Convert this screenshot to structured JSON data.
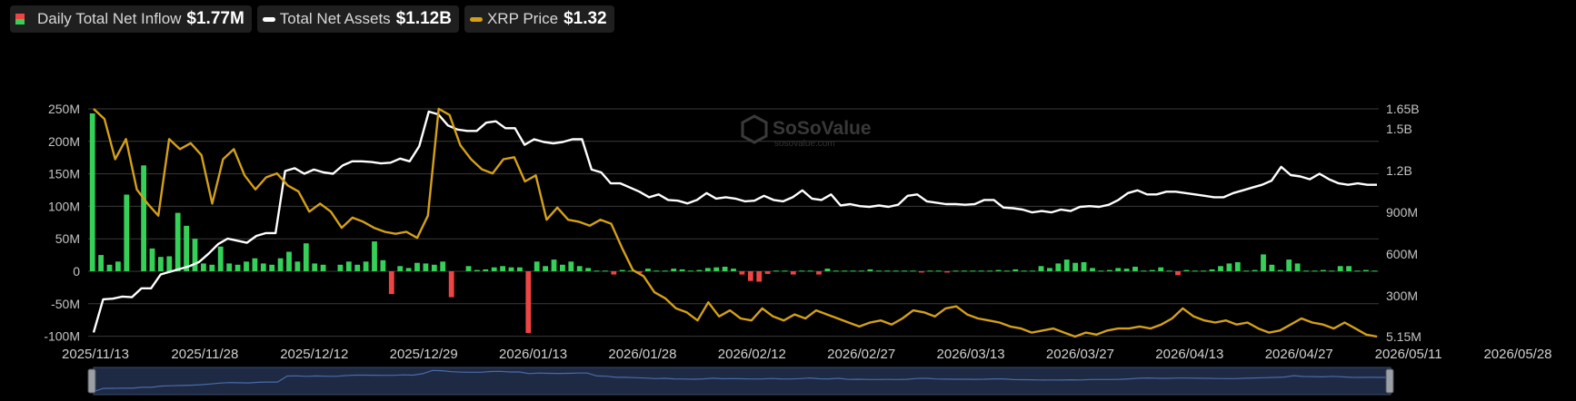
{
  "legend": [
    {
      "label": "Daily Total Net Inflow",
      "value": "$1.77M",
      "icon": "bar-swatch"
    },
    {
      "label": "Total Net Assets",
      "value": "$1.12B",
      "icon": "line-swatch",
      "color": "#ffffff"
    },
    {
      "label": "XRP Price",
      "value": "$1.32",
      "icon": "line-swatch",
      "color": "#d4a017"
    }
  ],
  "watermark": {
    "brand": "SoSoValue",
    "url": "sosovalue.com"
  },
  "chart_data": {
    "type": "bar",
    "x_ticks": [
      "2025/11/13",
      "2025/11/28",
      "2025/12/12",
      "2025/12/29",
      "2026/01/13",
      "2026/01/28",
      "2026/02/12",
      "2026/02/27",
      "2026/03/13",
      "2026/03/27",
      "2026/04/13",
      "2026/04/27",
      "2026/05/11",
      "2026/05/28"
    ],
    "y_left_ticks": [
      "250M",
      "200M",
      "150M",
      "100M",
      "50M",
      "0",
      "-50M",
      "-100M"
    ],
    "y_left_range": [
      -100,
      250
    ],
    "y_right_ticks": [
      "1.65B",
      "1.5B",
      "1.2B",
      "900M",
      "600M",
      "300M",
      "5.15M"
    ],
    "grid": true,
    "legend_position": "top-left",
    "colors": {
      "positive": "#34d058",
      "negative": "#ef4444",
      "assets": "#ffffff",
      "price": "#d4a017",
      "grid": "#3a3a3a"
    },
    "series": [
      {
        "name": "Daily Total Net Inflow",
        "type": "bar",
        "unit": "M USD",
        "values": [
          243,
          25,
          10,
          15,
          118,
          0,
          163,
          35,
          22,
          23,
          90,
          70,
          50,
          12,
          10,
          38,
          12,
          10,
          15,
          20,
          12,
          10,
          20,
          30,
          15,
          43,
          12,
          10,
          0,
          10,
          15,
          10,
          15,
          46,
          17,
          -35,
          8,
          5,
          13,
          12,
          10,
          15,
          -40,
          0,
          8,
          2,
          3,
          6,
          8,
          6,
          6,
          -95,
          15,
          8,
          18,
          10,
          15,
          8,
          5,
          1,
          1,
          -5,
          2,
          1,
          -3,
          4,
          1,
          1,
          4,
          3,
          1,
          2,
          5,
          6,
          7,
          4,
          -5,
          -15,
          -16,
          -4,
          1,
          1,
          -5,
          1,
          1,
          -5,
          4,
          1,
          1,
          1,
          1,
          3,
          1,
          1,
          1,
          1,
          1,
          -2,
          1,
          1,
          -2,
          1,
          1,
          1,
          1,
          1,
          2,
          1,
          3,
          1,
          1,
          8,
          5,
          12,
          18,
          13,
          14,
          5,
          1,
          2,
          5,
          4,
          7,
          1,
          2,
          6,
          1,
          -6,
          2,
          1,
          1,
          3,
          8,
          12,
          14,
          1,
          2,
          26,
          10,
          2,
          18,
          12,
          1,
          1,
          2,
          1,
          8,
          8,
          1,
          2,
          1
        ],
        "date_range": [
          "2025/11/13",
          "2026/05/28"
        ]
      },
      {
        "name": "Total Net Assets",
        "type": "line",
        "unit": "M USD",
        "values": [
          30,
          270,
          275,
          290,
          285,
          350,
          350,
          450,
          470,
          490,
          510,
          540,
          600,
          670,
          710,
          695,
          680,
          730,
          750,
          750,
          1200,
          1220,
          1180,
          1210,
          1190,
          1180,
          1240,
          1270,
          1270,
          1265,
          1255,
          1260,
          1290,
          1270,
          1380,
          1630,
          1610,
          1530,
          1500,
          1490,
          1490,
          1550,
          1560,
          1510,
          1510,
          1390,
          1430,
          1410,
          1400,
          1410,
          1430,
          1430,
          1210,
          1190,
          1110,
          1110,
          1080,
          1050,
          1010,
          1030,
          990,
          985,
          965,
          990,
          1040,
          1000,
          1010,
          1000,
          980,
          985,
          1020,
          990,
          980,
          1010,
          1060,
          1000,
          990,
          1030,
          950,
          960,
          945,
          940,
          950,
          940,
          955,
          1020,
          1030,
          980,
          970,
          960,
          960,
          955,
          960,
          990,
          990,
          935,
          930,
          920,
          900,
          910,
          900,
          920,
          910,
          940,
          945,
          940,
          955,
          990,
          1040,
          1060,
          1030,
          1030,
          1050,
          1050,
          1040,
          1030,
          1020,
          1010,
          1010,
          1040,
          1060,
          1080,
          1100,
          1130,
          1230,
          1170,
          1160,
          1140,
          1180,
          1140,
          1110,
          1100,
          1110,
          1100,
          1100
        ]
      },
      {
        "name": "XRP Price",
        "type": "line",
        "unit": "USD",
        "values": [
          2.45,
          2.4,
          2.2,
          2.3,
          2.05,
          1.98,
          1.92,
          2.3,
          2.25,
          2.28,
          2.22,
          1.98,
          2.2,
          2.25,
          2.12,
          2.05,
          2.11,
          2.13,
          2.07,
          2.04,
          1.94,
          1.98,
          1.94,
          1.86,
          1.91,
          1.89,
          1.86,
          1.84,
          1.83,
          1.84,
          1.81,
          1.92,
          2.45,
          2.42,
          2.27,
          2.2,
          2.15,
          2.13,
          2.2,
          2.21,
          2.09,
          2.12,
          1.9,
          1.96,
          1.9,
          1.89,
          1.87,
          1.9,
          1.88,
          1.76,
          1.65,
          1.62,
          1.54,
          1.51,
          1.46,
          1.44,
          1.4,
          1.49,
          1.42,
          1.45,
          1.41,
          1.4,
          1.46,
          1.42,
          1.4,
          1.43,
          1.41,
          1.45,
          1.43,
          1.41,
          1.39,
          1.37,
          1.39,
          1.4,
          1.38,
          1.41,
          1.45,
          1.44,
          1.42,
          1.46,
          1.47,
          1.43,
          1.41,
          1.4,
          1.39,
          1.37,
          1.36,
          1.34,
          1.35,
          1.36,
          1.34,
          1.32,
          1.34,
          1.33,
          1.35,
          1.36,
          1.36,
          1.37,
          1.36,
          1.38,
          1.41,
          1.46,
          1.42,
          1.4,
          1.39,
          1.4,
          1.38,
          1.39,
          1.36,
          1.34,
          1.35,
          1.38,
          1.41,
          1.39,
          1.38,
          1.36,
          1.39,
          1.36,
          1.33,
          1.32
        ]
      }
    ]
  }
}
